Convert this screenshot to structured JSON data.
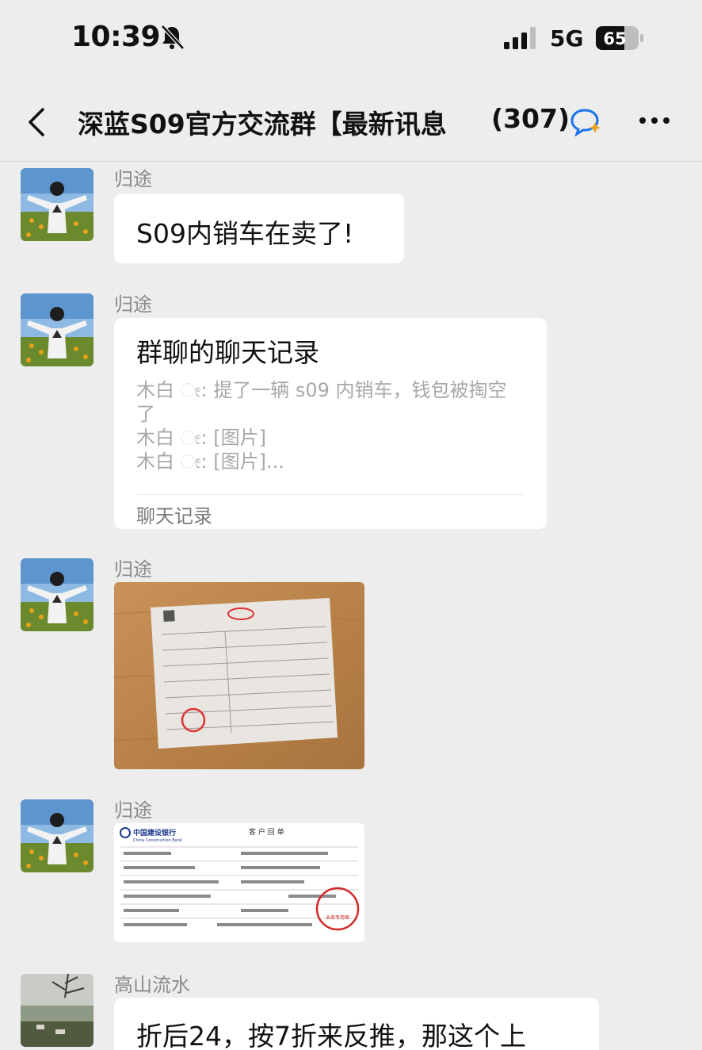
{
  "status_bar": {
    "time": "10:39",
    "network": "5G",
    "battery": "65"
  },
  "nav": {
    "title": "深蓝S09官方交流群【最新讯息",
    "member_count": "(307)"
  },
  "messages": [
    {
      "sender": "归途",
      "text": "S09内销车在卖了!"
    },
    {
      "sender": "归途",
      "card": {
        "title": "群聊的聊天记录",
        "lines": [
          "木白 ೕ: 提了一辆 s09 内销车，钱包被掏空",
          "了",
          "木白 ೕ: [图片]",
          "木白 ೕ: [图片]..."
        ],
        "footer": "聊天记录"
      }
    },
    {
      "sender": "归途"
    },
    {
      "sender": "归途",
      "receipt": {
        "bank_name": "中国建设银行",
        "bank_name_en": "China Construction Bank",
        "heading": "客 户 回 单",
        "stamp_text": "业务专用章"
      }
    },
    {
      "sender": "高山流水",
      "text": "折后24，按7折来反推，那这个上"
    }
  ],
  "icons": {
    "bell": "bell-slash-icon",
    "signal": "signal-icon",
    "battery": "battery-icon",
    "back": "chevron-left-icon",
    "group_bubble": "chat-bubble-icon",
    "more": "more-dots-icon"
  },
  "colors": {
    "background": "#ededed",
    "bubble": "#ffffff",
    "sender": "#8a8a8a",
    "card_text": "#a8a8a8",
    "stamp": "#d22a2a"
  }
}
